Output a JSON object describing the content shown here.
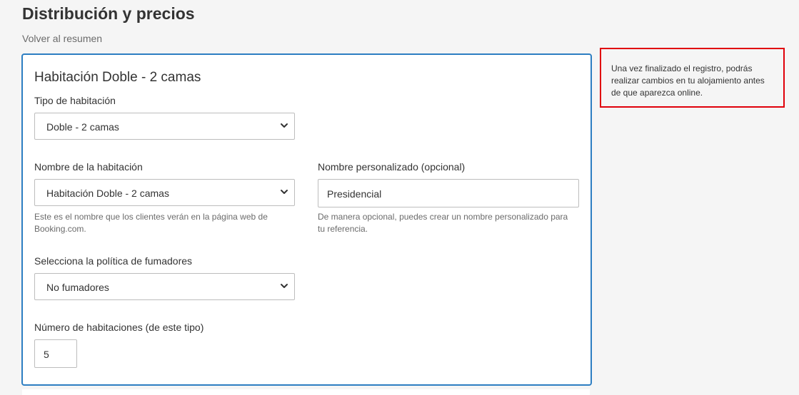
{
  "header": {
    "title": "Distribución y precios",
    "back_link": "Volver al resumen"
  },
  "room": {
    "title": "Habitación Doble - 2 camas",
    "room_type": {
      "label": "Tipo de habitación",
      "selected": "Doble - 2 camas"
    },
    "room_name": {
      "label": "Nombre de la habitación",
      "selected": "Habitación Doble - 2 camas",
      "help": "Este es el nombre que los clientes verán en la página web de Booking.com."
    },
    "custom_name": {
      "label": "Nombre personalizado (opcional)",
      "value": "Presidencial",
      "help": "De manera opcional, puedes crear un nombre personalizado para tu referencia."
    },
    "smoking_policy": {
      "label": "Selecciona la política de fumadores",
      "selected": "No fumadores"
    },
    "room_count": {
      "label": "Número de habitaciones (de este tipo)",
      "value": "5"
    }
  },
  "sidebar": {
    "info_text": "Una vez finalizado el registro, podrás realizar cambios en tu alojamiento antes de que aparezca online."
  },
  "colors": {
    "card_border": "#2d7ec2",
    "info_border": "#e0000a",
    "background": "#f5f5f5"
  }
}
